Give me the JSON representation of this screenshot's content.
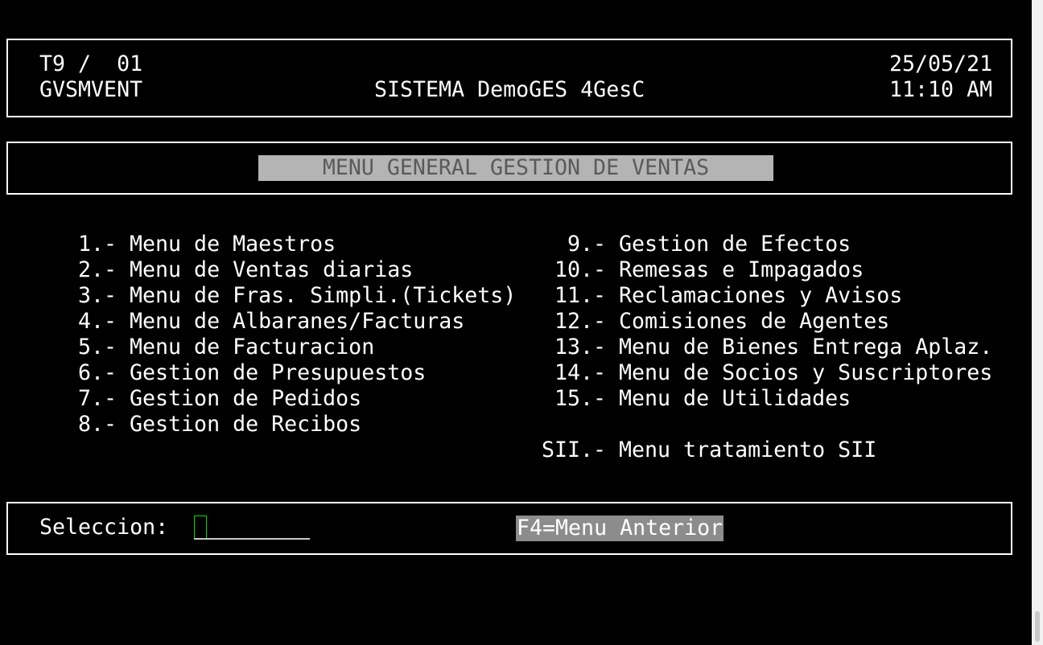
{
  "header": {
    "terminal_id": "T9 /  01",
    "program": "GVSMVENT",
    "system_name": "SISTEMA DemoGES 4GesC",
    "date": "25/05/21",
    "time": "11:10 AM"
  },
  "menu_title": "MENU GENERAL GESTION DE VENTAS",
  "menu": {
    "left": [
      {
        "num": "1.-",
        "label": "Menu de Maestros"
      },
      {
        "num": "2.-",
        "label": "Menu de Ventas diarias"
      },
      {
        "num": "3.-",
        "label": "Menu de Fras. Simpli.(Tickets)"
      },
      {
        "num": "4.-",
        "label": "Menu de Albaranes/Facturas"
      },
      {
        "num": "5.-",
        "label": "Menu de Facturacion"
      },
      {
        "num": "6.-",
        "label": "Gestion de Presupuestos"
      },
      {
        "num": "7.-",
        "label": "Gestion de Pedidos"
      },
      {
        "num": "8.-",
        "label": "Gestion de Recibos"
      }
    ],
    "right": [
      {
        "num": "9.-",
        "label": "Gestion de Efectos"
      },
      {
        "num": "10.-",
        "label": "Remesas e Impagados"
      },
      {
        "num": "11.-",
        "label": "Reclamaciones y Avisos"
      },
      {
        "num": "12.-",
        "label": "Comisiones de Agentes"
      },
      {
        "num": "13.-",
        "label": "Menu de Bienes Entrega Aplaz."
      },
      {
        "num": "14.-",
        "label": "Menu de Socios y Suscriptores"
      },
      {
        "num": "15.-",
        "label": "Menu de Utilidades"
      },
      {
        "num": "SII.-",
        "label": "Menu tratamiento SII"
      }
    ]
  },
  "footer": {
    "selection_label": "Seleccion:",
    "selection_value": "",
    "fkey_label": "F4=Menu Anterior"
  },
  "colors": {
    "background": "#000000",
    "foreground": "#ffffff",
    "title_bg": "#b4b4b4",
    "title_fg": "#5a5a5a",
    "cursor": "#00e000",
    "fkey_bg": "#8c8c8c"
  }
}
